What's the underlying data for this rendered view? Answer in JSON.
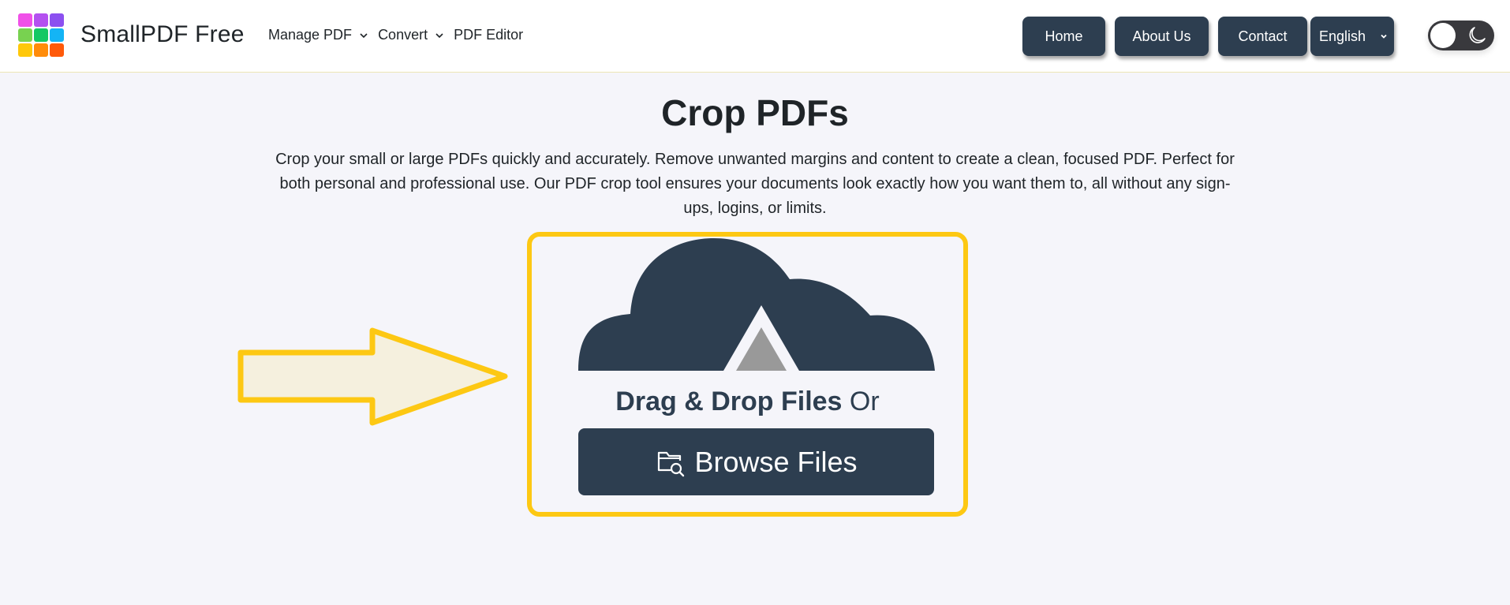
{
  "header": {
    "logo": {
      "name": "app-grid-logo",
      "colors": [
        "#f050e8",
        "#b450f0",
        "#8c50f0",
        "#78d250",
        "#14c864",
        "#14b4f5",
        "#ffc80a",
        "#ff8c0a",
        "#ff5a0a"
      ]
    },
    "brand": "SmallPDF Free",
    "nav": [
      {
        "label": "Manage PDF",
        "has_dropdown": true,
        "icon": "chevron-down-icon"
      },
      {
        "label": "Convert",
        "has_dropdown": true,
        "icon": "chevron-down-icon"
      },
      {
        "label": "PDF Editor",
        "has_dropdown": false
      }
    ],
    "buttons": {
      "home": "Home",
      "about": "About Us",
      "contact": "Contact"
    },
    "language_select": {
      "selected": "English",
      "icon": "chevron-down-icon"
    },
    "theme_toggle": {
      "state": "light",
      "icon": "moon-icon"
    }
  },
  "main": {
    "title": "Crop PDFs",
    "description": "Crop your small or large PDFs quickly and accurately. Remove unwanted margins and content to create a clean, focused PDF. Perfect for both personal and professional use. Our PDF crop tool ensures your documents look exactly how you want them to, all without any sign-ups, logins, or limits.",
    "dropzone": {
      "icon": "cloud-upload-icon",
      "drag_text_bold": "Drag & Drop Files",
      "drag_text_normal": "Or",
      "browse_label": "Browse Files",
      "browse_icon": "folder-search-icon"
    },
    "pointer_arrow": {
      "icon": "arrow-right-icon"
    }
  },
  "colors": {
    "primary_dark": "#2d3e50",
    "highlight_yellow": "#fdc813",
    "arrow_fill": "#f5f0de",
    "background": "#f5f5fa"
  }
}
